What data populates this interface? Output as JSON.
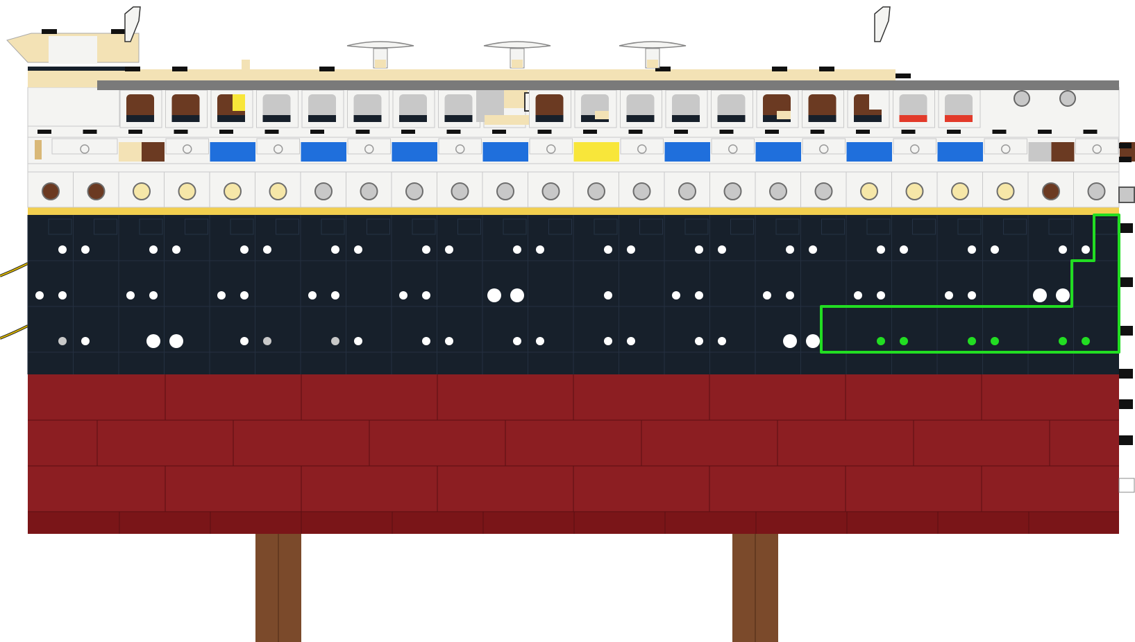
{
  "palette": {
    "white": "#f4f4f2",
    "white_edge": "#c9c9c9",
    "tan": "#f3e2b5",
    "dark_tan": "#d9b877",
    "tan_bright": "#f6e7a8",
    "navy": "#17202b",
    "dark_red": "#8c1e22",
    "dark_red_lines": "#5a0f12",
    "yellow_stripe": "#f2cf4f",
    "blue": "#1f6fdc",
    "yellow": "#f8e63a",
    "reddish_brown": "#6b3a22",
    "brown_leg": "#7b4a2b",
    "light_gray": "#c8c8c8",
    "dark_gray": "#7a7a7a",
    "black": "#111111",
    "red": "#e23a2a",
    "highlight_green": "#22dd22",
    "rope": "#d8b400"
  },
  "selection": {
    "color": "#22dd22",
    "description_visible": false
  }
}
